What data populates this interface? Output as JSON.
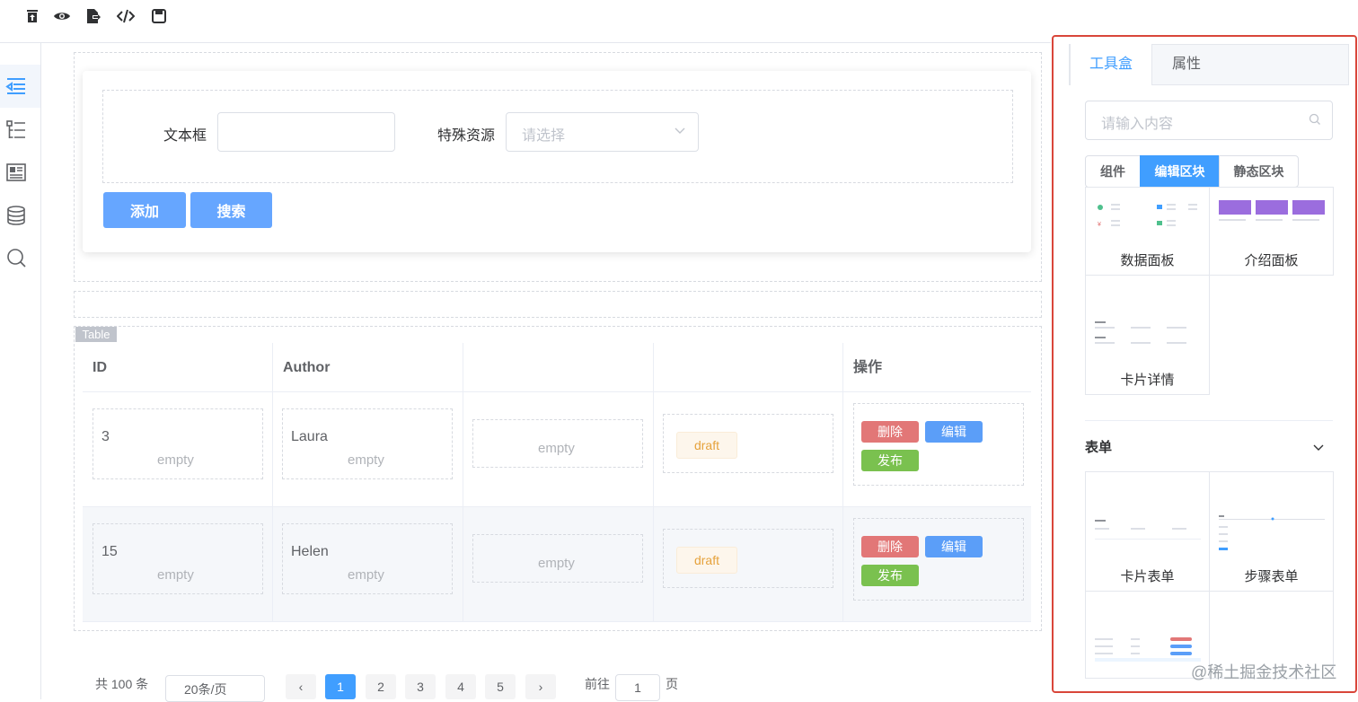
{
  "toolbar": {
    "icons": [
      "delete-icon",
      "preview-icon",
      "export-icon",
      "code-icon",
      "save-icon"
    ]
  },
  "sidebar": {
    "icons": [
      "outline-icon",
      "tree-icon",
      "layout-icon",
      "database-icon",
      "search-icon"
    ]
  },
  "form": {
    "field1_label": "文本框",
    "field2_label": "特殊资源",
    "field2_placeholder": "请选择",
    "add_button": "添加",
    "search_button": "搜索"
  },
  "table": {
    "tag": "Table",
    "columns": [
      "ID",
      "Author",
      "",
      "",
      "操作"
    ],
    "rows": [
      {
        "id": "3",
        "author": "Laura",
        "status": "draft"
      },
      {
        "id": "15",
        "author": "Helen",
        "status": "draft"
      }
    ],
    "empty_text": "empty",
    "actions": {
      "delete": "删除",
      "edit": "编辑",
      "publish": "发布"
    }
  },
  "pagination": {
    "total_text": "共 100 条",
    "page_size_text": "20条/页",
    "pages": [
      "1",
      "2",
      "3",
      "4",
      "5"
    ],
    "goto_text": "前往",
    "goto_value": "1",
    "page_unit": "页"
  },
  "panel": {
    "tabs": [
      "工具盒",
      "属性"
    ],
    "search_placeholder": "请输入内容",
    "segments": [
      "组件",
      "编辑区块",
      "静态区块"
    ],
    "blocks": [
      "数据面板",
      "介绍面板",
      "卡片详情"
    ],
    "section_title": "表单",
    "form_blocks": [
      "卡片表单",
      "步骤表单"
    ]
  },
  "watermark": "@稀土掘金技术社区",
  "colors": {
    "accent": "#409eff",
    "danger": "#e27777",
    "success": "#7ac14f",
    "warning": "#e6a23c",
    "highlight_frame": "#d9463a"
  }
}
